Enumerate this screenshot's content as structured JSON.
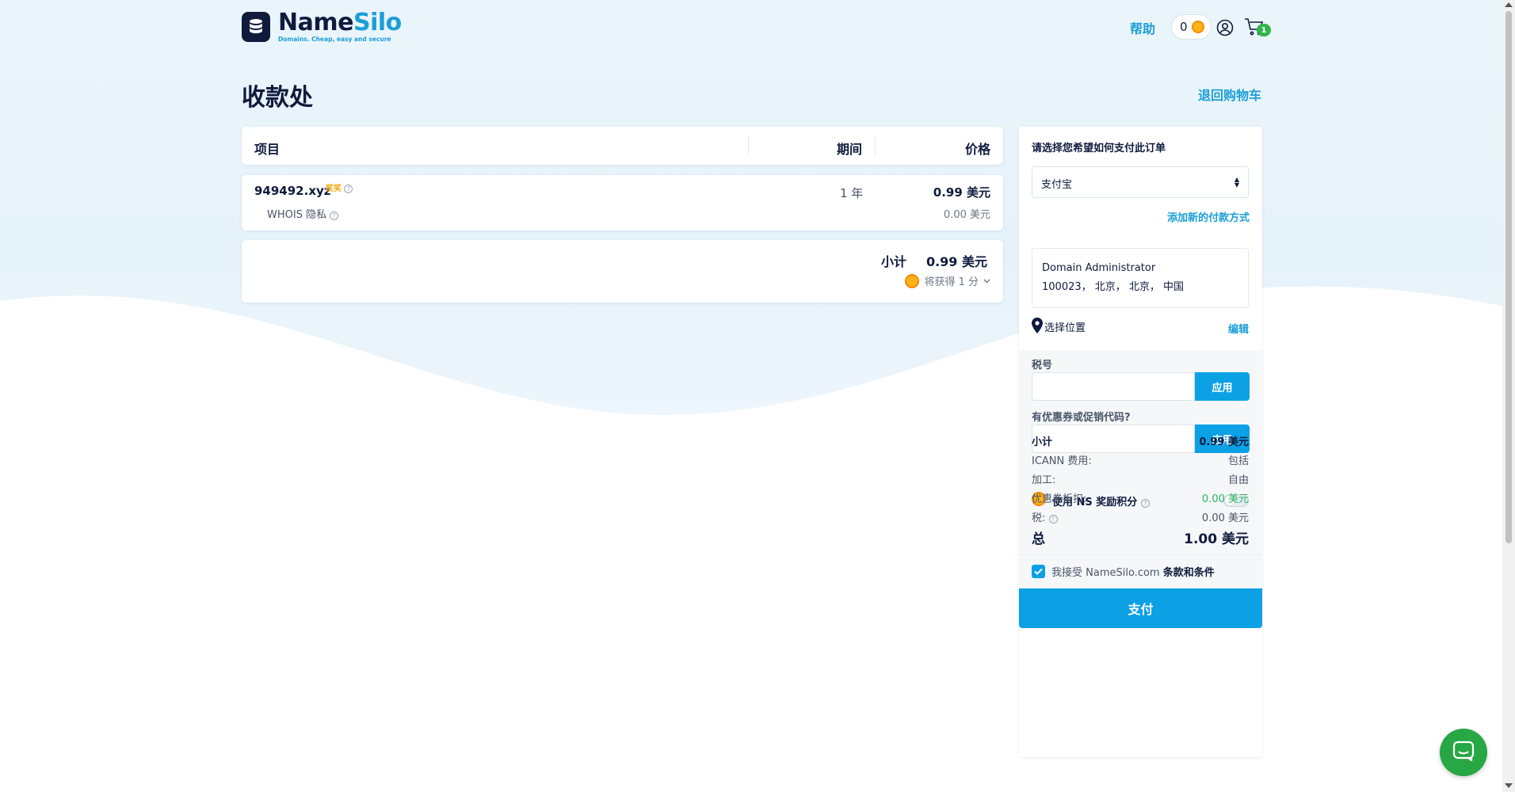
{
  "header": {
    "logo_name_a": "Name",
    "logo_name_b": "Silo",
    "logo_tagline": "Domains. Cheap, easy and secure",
    "help_label": "帮助",
    "coin_count": "0",
    "cart_count": "1"
  },
  "page": {
    "title": "收款处",
    "back_link": "退回购物车"
  },
  "items_table": {
    "columns": [
      "项目",
      "期间",
      "价格"
    ],
    "rows": [
      {
        "domain": "949492.xyz",
        "award": "奖奖",
        "period": "1 年",
        "price": "0.99 美元",
        "sub_label": "WHOIS 隐私",
        "sub_price": "0.00 美元"
      }
    ]
  },
  "subtotal": {
    "label": "小计",
    "value": "0.99 美元",
    "earn_text": "将获得 1 分"
  },
  "sidebar": {
    "payment_title": "请选择您希望如何支付此订单",
    "payment_method": "支付宝",
    "add_payment": "添加新的付款方式",
    "address_name": "Domain Administrator",
    "address_line": "100023， 北京， 北京， 中国",
    "location_label": "选择位置",
    "edit_label": "编辑",
    "tax_label": "税号",
    "tax_placeholder": "",
    "apply_label": "应用",
    "coupon_label": "有优惠券或促销代码?",
    "coupon_placeholder": "",
    "rewards_label": "使用 NS 奖励积分",
    "rewards_enabled": false,
    "summary": [
      {
        "key": "小计",
        "value": "0.99 美元"
      },
      {
        "key": "ICANN 费用:",
        "value": "包括"
      },
      {
        "key": "加工:",
        "value": "自由"
      },
      {
        "key": "优惠券折扣:",
        "value": "0.00 美元"
      },
      {
        "key": "税:",
        "value": "0.00 美元"
      }
    ],
    "total_label": "总",
    "total_value": "1.00 美元",
    "terms_prefix": "我接受 NameSilo.com",
    "terms_link": "条款和条件",
    "terms_checked": true,
    "pay_label": "支付"
  },
  "colors": {
    "accent": "#0ca0e5",
    "brand_dark": "#0f1b3d",
    "success": "#28b463",
    "coin": "#ffb31a"
  }
}
